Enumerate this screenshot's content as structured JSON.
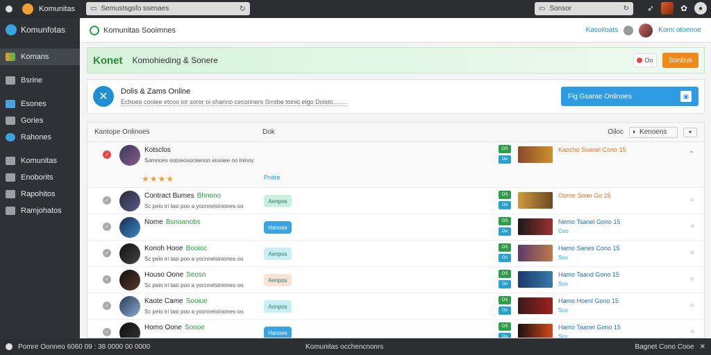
{
  "browser": {
    "app_name": "Komunitas",
    "url_text": "Semustsgsfo ssenaes",
    "search_text": "Sonsor"
  },
  "sidebar": {
    "title": "Komunfotas",
    "items": [
      {
        "label": "Komans",
        "active": true
      },
      {
        "label": "Bsrine",
        "active": false
      },
      {
        "label": "Esones",
        "active": false
      },
      {
        "label": "Gories",
        "active": false
      },
      {
        "label": "Rahones",
        "active": false
      },
      {
        "label": "Komunitas",
        "active": false
      },
      {
        "label": "Enoborits",
        "active": false
      },
      {
        "label": "Rapohitos",
        "active": false
      },
      {
        "label": "Ramjohatos",
        "active": false
      }
    ]
  },
  "header": {
    "title": "Komunitas Sooimnes",
    "right_link": "Kasoitoats",
    "user_link": "Komi otoenoe"
  },
  "banner": {
    "brand": "Konet",
    "subtitle": "Komohieding & Sonere",
    "icon_text": "Oo",
    "button_label": "Sonbus"
  },
  "card": {
    "title": "Dolis & Zams Online",
    "description": "Echoeo coniee etcoo ior soror oi sharino cecoriners  Srrobe toinic elgo Doisto........",
    "button_label": "Fig Gsarae Onlinoes"
  },
  "table": {
    "col1": "Kantope Onlinoes",
    "col2": "Dok",
    "filter_label": "Oiloc",
    "select_label": "Kenoens",
    "rows": [
      {
        "name": "Kotsclos",
        "tag": "",
        "desc": "Somnoes ootoeosoceeoon eiooiee oo lninoy",
        "pill": "",
        "pill_color": "",
        "flag": "OS",
        "flag2": "Oo",
        "title": "Kaocho Soanel Cono 15",
        "title_orange": true,
        "sub": "",
        "thumb": "linear-gradient(90deg,#8a4a2a,#d0902a)",
        "avatar": "linear-gradient(135deg,#3a3a5a,#8a5a8a)",
        "red": true,
        "expanded": true,
        "stars": "★★★★",
        "online": "Pnitre"
      },
      {
        "name": "Contract Bumes",
        "tag": "Bhnono",
        "desc": "Sc peio iri tasi poo a yocnnelsiniones oo",
        "pill": "Aenpos",
        "pill_color": "#c9f0e0",
        "flag": "OS",
        "flag2": "Oo",
        "title": "Oorne Soan Go 15",
        "title_orange": true,
        "sub": "",
        "thumb": "linear-gradient(90deg,#d09a40,#6a4a20)",
        "avatar": "linear-gradient(135deg,#2a2a3a,#5a5a8a)",
        "red": false,
        "expanded": false,
        "stars": "",
        "online": ""
      },
      {
        "name": "Nome",
        "tag": "Bsnoanobs",
        "desc": "",
        "pill": "Hanoes",
        "pill_color": "#3aa3e0",
        "flag": "OS",
        "flag2": "Oo",
        "title": "Nemo Tsanel Gono 15",
        "title_orange": false,
        "sub": "Coo",
        "thumb": "linear-gradient(90deg,#1a1a1a,#a03030)",
        "avatar": "linear-gradient(135deg,#1a2a5a,#3a8aba)",
        "red": false,
        "expanded": false,
        "stars": "",
        "online": ""
      },
      {
        "name": "Konoh Hooe",
        "tag": "Booioc",
        "desc": "Sc peio iri tasi poo a yocnnelsiniones oo",
        "pill": "Aenpos",
        "pill_color": "#c9f0f4",
        "flag": "OS",
        "flag2": "Oo",
        "title": "Hamo Sanes Cono 15",
        "title_orange": false,
        "sub": "Sco",
        "thumb": "linear-gradient(90deg,#5a3a6a,#c07a4a)",
        "avatar": "linear-gradient(135deg,#111,#444)",
        "red": false,
        "expanded": false,
        "stars": "",
        "online": ""
      },
      {
        "name": "Houso Oone",
        "tag": "Seosn",
        "desc": "Sc peio iri tasi poo a yocnnelsiniones oo",
        "pill": "Aenpos",
        "pill_color": "#f8e4d4",
        "flag": "OS",
        "flag2": "Oo",
        "title": "Hamo Taand Gono 15",
        "title_orange": false,
        "sub": "Sco",
        "thumb": "linear-gradient(90deg,#1a3a6a,#3a7aaa)",
        "avatar": "linear-gradient(135deg,#111,#5a3a2a)",
        "red": false,
        "expanded": false,
        "stars": "",
        "online": ""
      },
      {
        "name": "Kaote Came",
        "tag": "Sooiue",
        "desc": "Sc peio iri tasi poo a yocnnelsiniones oo",
        "pill": "Aonpos",
        "pill_color": "#c9f0f4",
        "flag": "OS",
        "flag2": "Oo",
        "title": "Hamo Hoenl Gono 15",
        "title_orange": false,
        "sub": "Sco",
        "thumb": "linear-gradient(90deg,#3a1a1a,#a02020)",
        "avatar": "linear-gradient(135deg,#2a3a5a,#8aaacc)",
        "red": false,
        "expanded": false,
        "stars": "",
        "online": ""
      },
      {
        "name": "Homo Oone",
        "tag": "Sonoe",
        "desc": "",
        "pill": "Hanoes",
        "pill_color": "#3aa3e0",
        "flag": "OS",
        "flag2": "Oo",
        "title": "Hamo Taanel Gono 15",
        "title_orange": false,
        "sub": "Sco",
        "thumb": "linear-gradient(90deg,#1a1010,#d04a1a)",
        "avatar": "linear-gradient(135deg,#111,#333)",
        "red": false,
        "expanded": false,
        "stars": "",
        "online": ""
      }
    ]
  },
  "statusbar": {
    "left": "Pomre Oonneo 6060 09 : 38 0000 00 0000",
    "middle": "Komunitas occhencnonrs",
    "right": "Bagnet Cono Cooe"
  }
}
